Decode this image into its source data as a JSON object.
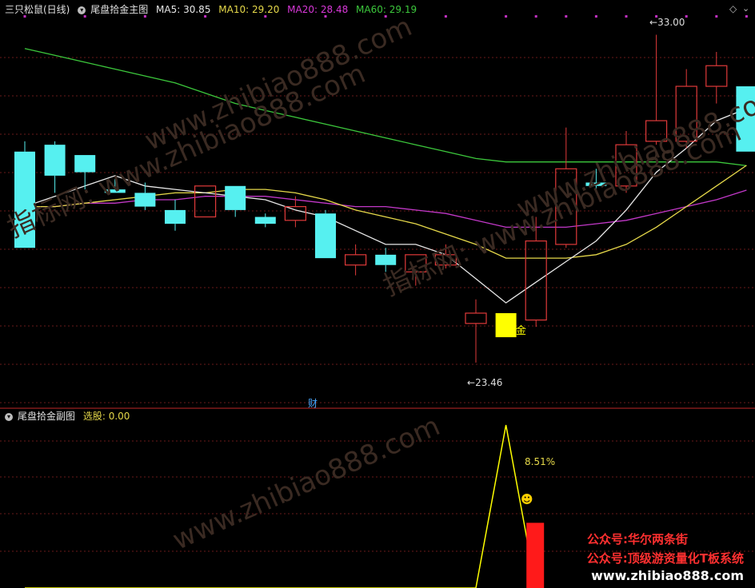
{
  "main_panel": {
    "stock_label": "三只松鼠(日线)",
    "indicator_label": "尾盘拾金主图",
    "ma": [
      {
        "label": "MA5: 30.85",
        "color": "#e8e8e8"
      },
      {
        "label": "MA10: 29.20",
        "color": "#e6d94a"
      },
      {
        "label": "MA20: 28.48",
        "color": "#d838d8"
      },
      {
        "label": "MA60: 29.19",
        "color": "#3cc83c"
      }
    ],
    "high_label": "33.00",
    "low_label": "23.46",
    "signal_label": "▲拾金",
    "cai_marker": "财"
  },
  "sub_panel": {
    "indicator_label": "尾盘拾金副图",
    "xuangu_label": "选股: 0.00",
    "percent_label": "8.51%",
    "smile": "☻"
  },
  "watermarks": [
    "www.zhibiao888.com",
    "指标网: www.zhibiao888.com",
    "www.zhibiao888.com",
    "指标网: www.zhibiao888.com",
    "指标网:"
  ],
  "ads": [
    "公众号:华尔两条街",
    "公众号:顶级游资量化T板系统",
    "www.zhibiao888.com"
  ],
  "colors": {
    "up": "#e03a3a",
    "down": "#56f0f0",
    "signal": "#ffff00",
    "ma5": "#e8e8e8",
    "ma10": "#e6d94a",
    "ma20": "#c238c8",
    "ma60": "#3cc83c",
    "grid": "#6a1a1a"
  },
  "chart_data": {
    "type": "candlestick",
    "ylim": [
      22.9,
      33.5
    ],
    "candles": [
      {
        "o": 29.6,
        "h": 29.9,
        "l": 26.8,
        "c": 26.8
      },
      {
        "o": 29.8,
        "h": 29.9,
        "l": 28.4,
        "c": 28.9
      },
      {
        "o": 29.5,
        "h": 29.5,
        "l": 28.5,
        "c": 29.0
      },
      {
        "o": 28.5,
        "h": 28.8,
        "l": 28.4,
        "c": 28.4
      },
      {
        "o": 28.4,
        "h": 28.7,
        "l": 27.9,
        "c": 28.0
      },
      {
        "o": 27.9,
        "h": 28.2,
        "l": 27.3,
        "c": 27.5
      },
      {
        "o": 27.7,
        "h": 28.6,
        "l": 27.7,
        "c": 28.6
      },
      {
        "o": 28.6,
        "h": 28.6,
        "l": 27.7,
        "c": 27.9
      },
      {
        "o": 27.7,
        "h": 27.8,
        "l": 27.4,
        "c": 27.5
      },
      {
        "o": 27.6,
        "h": 28.3,
        "l": 27.4,
        "c": 28.0
      },
      {
        "o": 27.8,
        "h": 27.9,
        "l": 26.5,
        "c": 26.5
      },
      {
        "o": 26.3,
        "h": 26.9,
        "l": 26.0,
        "c": 26.6
      },
      {
        "o": 26.6,
        "h": 26.8,
        "l": 26.1,
        "c": 26.3
      },
      {
        "o": 26.1,
        "h": 26.6,
        "l": 25.7,
        "c": 26.6
      },
      {
        "o": 26.3,
        "h": 26.9,
        "l": 26.2,
        "c": 26.6
      },
      {
        "o": 24.6,
        "h": 25.3,
        "l": 23.46,
        "c": 24.9
      },
      {
        "o": 24.9,
        "h": 24.9,
        "l": 24.2,
        "c": 24.2
      },
      {
        "o": 24.7,
        "h": 27.7,
        "l": 24.5,
        "c": 27.0
      },
      {
        "o": 26.9,
        "h": 30.3,
        "l": 26.8,
        "c": 29.1
      },
      {
        "o": 28.7,
        "h": 29.1,
        "l": 28.4,
        "c": 28.6
      },
      {
        "o": 28.6,
        "h": 30.2,
        "l": 28.4,
        "c": 29.8
      },
      {
        "o": 29.9,
        "h": 33.0,
        "l": 29.8,
        "c": 30.5
      },
      {
        "o": 29.9,
        "h": 32.0,
        "l": 29.7,
        "c": 31.5
      },
      {
        "o": 31.5,
        "h": 32.5,
        "l": 31.0,
        "c": 32.1
      },
      {
        "o": 31.5,
        "h": 31.5,
        "l": 29.6,
        "c": 29.6
      }
    ],
    "ma5": [
      28.0,
      28.3,
      28.6,
      28.9,
      28.6,
      28.5,
      28.4,
      28.3,
      28.2,
      27.9,
      27.7,
      27.3,
      26.9,
      26.9,
      26.6,
      25.9,
      25.2,
      25.8,
      26.4,
      27.0,
      27.9,
      29.0,
      29.7,
      30.5,
      30.85
    ],
    "ma10": [
      28.0,
      28.0,
      28.1,
      28.2,
      28.3,
      28.4,
      28.4,
      28.5,
      28.5,
      28.4,
      28.2,
      27.9,
      27.7,
      27.5,
      27.2,
      26.9,
      26.5,
      26.5,
      26.5,
      26.6,
      26.9,
      27.4,
      28.0,
      28.6,
      29.2
    ],
    "ma20": [
      28.0,
      28.0,
      28.1,
      28.1,
      28.2,
      28.2,
      28.3,
      28.3,
      28.3,
      28.2,
      28.1,
      28.0,
      28.0,
      27.9,
      27.8,
      27.6,
      27.4,
      27.4,
      27.4,
      27.5,
      27.6,
      27.8,
      28.0,
      28.2,
      28.48
    ],
    "ma60": [
      32.6,
      32.4,
      32.2,
      32.0,
      31.8,
      31.6,
      31.3,
      31.0,
      30.8,
      30.6,
      30.4,
      30.2,
      30.0,
      29.8,
      29.6,
      29.4,
      29.3,
      29.3,
      29.3,
      29.3,
      29.3,
      29.3,
      29.3,
      29.3,
      29.19
    ],
    "sub_line": [
      0,
      0,
      0,
      0,
      0,
      0,
      0,
      0,
      0,
      0,
      0,
      0,
      0,
      0,
      0,
      0,
      1,
      0
    ],
    "sub_bar": {
      "index": 17,
      "value": 0.4
    }
  }
}
